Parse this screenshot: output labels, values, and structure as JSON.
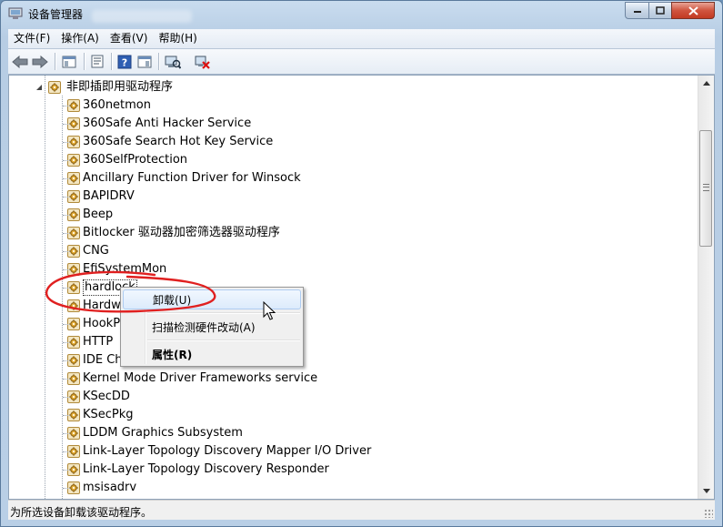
{
  "window": {
    "title": "设备管理器",
    "controls": {
      "minimize": "minimize-icon",
      "maximize": "maximize-icon",
      "close": "close-icon"
    }
  },
  "menu": [
    "文件(F)",
    "操作(A)",
    "查看(V)",
    "帮助(H)"
  ],
  "toolbar": {
    "buttons": [
      "back-arrow-icon",
      "forward-arrow-icon",
      "console-tree-icon",
      "properties-icon",
      "help-icon",
      "action-pane-icon",
      "scan-hardware-icon",
      "uninstall-icon"
    ]
  },
  "tree": {
    "category": "非即插即用驱动程序",
    "items": [
      "360netmon",
      "360Safe Anti Hacker Service",
      "360Safe Search Hot Key Service",
      "360SelfProtection",
      "Ancillary Function Driver for Winsock",
      "BAPIDRV",
      "Beep",
      "Bitlocker 驱动器加密筛选器驱动程序",
      "CNG",
      "EfiSystemMon",
      "hardlock",
      "Hardwa",
      "HookPo",
      "HTTP",
      "IDE Cha",
      "Kernel Mode Driver Frameworks service",
      "KSecDD",
      "KSecPkg",
      "LDDM Graphics Subsystem",
      "Link-Layer Topology Discovery Mapper I/O Driver",
      "Link-Layer Topology Discovery Responder",
      "msisadrv"
    ]
  },
  "context_menu": {
    "uninstall": "卸载(U)",
    "scan": "扫描检测硬件改动(A)",
    "properties": "属性(R)"
  },
  "status": "为所选设备卸载该驱动程序。",
  "colors": {
    "annotation": "#e02020",
    "selection": "#dcebfc",
    "tree_bg": "#ffffff"
  }
}
